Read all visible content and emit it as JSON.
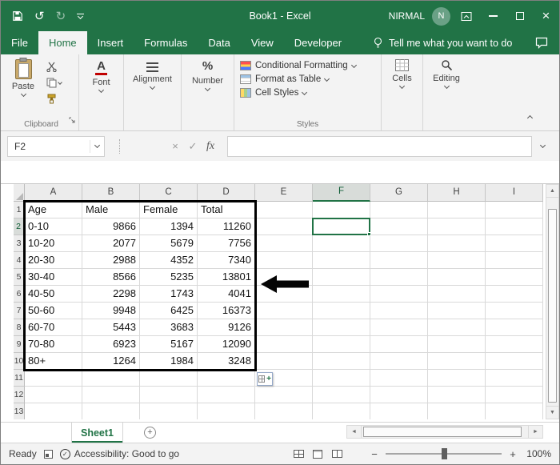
{
  "title_bar": {
    "title": "Book1  -  Excel",
    "user_name": "NIRMAL",
    "avatar_letter": "N"
  },
  "icons": {
    "undo": "↺",
    "redo": "↻",
    "close": "×",
    "formula_cancel": "×",
    "formula_enter": "✓",
    "fx": "fx",
    "scroll_up": "▲",
    "scroll_down": "▼",
    "scroll_left": "◄",
    "scroll_right": "►",
    "zoom_out": "−",
    "zoom_in": "+",
    "new_sheet": "+"
  },
  "ribbon_tabs": [
    {
      "label": "File",
      "file": true
    },
    {
      "label": "Home",
      "active": true
    },
    {
      "label": "Insert"
    },
    {
      "label": "Formulas"
    },
    {
      "label": "Data"
    },
    {
      "label": "View"
    },
    {
      "label": "Developer"
    }
  ],
  "tell_me": {
    "label": "Tell me what you want to do"
  },
  "ribbon": {
    "paste": "Paste",
    "clipboard_group": "Clipboard",
    "font": "Font",
    "alignment": "Alignment",
    "number": "Number",
    "conditional_formatting": "Conditional Formatting",
    "format_as_table": "Format as Table",
    "cell_styles": "Cell Styles",
    "styles_group": "Styles",
    "cells": "Cells",
    "editing": "Editing"
  },
  "formula_bar": {
    "name_box": "F2",
    "value": ""
  },
  "grid": {
    "columns": [
      "A",
      "B",
      "C",
      "D",
      "E",
      "F",
      "G",
      "H",
      "I"
    ],
    "rows": [
      "1",
      "2",
      "3",
      "4",
      "5",
      "6",
      "7",
      "8",
      "9",
      "10",
      "11",
      "12",
      "13"
    ],
    "selected_cell": "F2",
    "highlight_range": "A1:D10",
    "data": [
      [
        "Age",
        "Male",
        "Female",
        "Total"
      ],
      [
        "0-10",
        "9866",
        "1394",
        "11260"
      ],
      [
        "10-20",
        "2077",
        "5679",
        "7756"
      ],
      [
        "20-30",
        "2988",
        "4352",
        "7340"
      ],
      [
        "30-40",
        "8566",
        "5235",
        "13801"
      ],
      [
        "40-50",
        "2298",
        "1743",
        "4041"
      ],
      [
        "50-60",
        "9948",
        "6425",
        "16373"
      ],
      [
        "60-70",
        "5443",
        "3683",
        "9126"
      ],
      [
        "70-80",
        "6923",
        "5167",
        "12090"
      ],
      [
        "80+",
        "1264",
        "1984",
        "3248"
      ]
    ]
  },
  "sheet_tabs": [
    {
      "label": "Sheet1",
      "active": true
    }
  ],
  "status_bar": {
    "mode": "Ready",
    "accessibility": "Accessibility: Good to go",
    "zoom_level": "100%"
  }
}
